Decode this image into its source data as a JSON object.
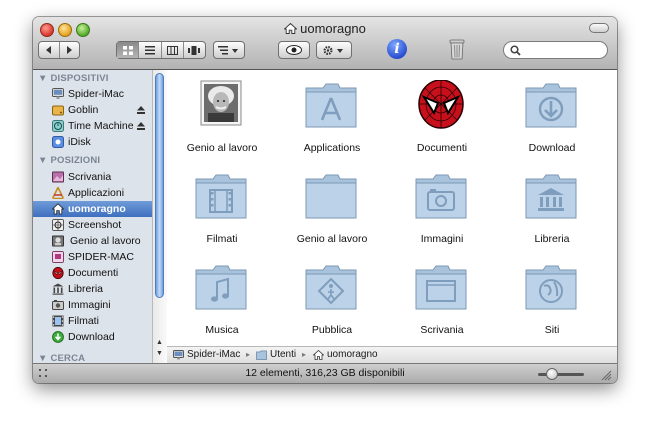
{
  "window": {
    "title": "uomoragno"
  },
  "toolbar": {
    "back_icon": "back-arrow-icon",
    "forward_icon": "forward-arrow-icon",
    "views": [
      "icon-view",
      "list-view",
      "column-view",
      "coverflow-view"
    ],
    "active_view": "icon-view",
    "search_placeholder": ""
  },
  "sidebar": {
    "sections": [
      {
        "label": "▼ DISPOSITIVI",
        "items": [
          {
            "label": "Spider-iMac",
            "icon": "imac-icon"
          },
          {
            "label": "Goblin",
            "icon": "drive-icon",
            "eject": true
          },
          {
            "label": "Time Machine",
            "icon": "time-machine-icon",
            "eject": true
          },
          {
            "label": "iDisk",
            "icon": "idisk-icon"
          }
        ]
      },
      {
        "label": "▼ POSIZIONI",
        "items": [
          {
            "label": "Scrivania",
            "icon": "desktop-icon"
          },
          {
            "label": "Applicazioni",
            "icon": "applications-icon"
          },
          {
            "label": "uomoragno",
            "icon": "home-icon",
            "selected": true
          },
          {
            "label": "Screenshot",
            "icon": "screenshot-icon"
          },
          {
            "label": "Genio al lavoro",
            "icon": "folder-icon"
          },
          {
            "label": "SPIDER-MAC",
            "icon": "computer-icon"
          },
          {
            "label": "Documenti",
            "icon": "spiderman-icon"
          },
          {
            "label": "Libreria",
            "icon": "library-icon"
          },
          {
            "label": "Immagini",
            "icon": "pictures-icon"
          },
          {
            "label": "Filmati",
            "icon": "movies-icon"
          },
          {
            "label": "Download",
            "icon": "download-icon"
          }
        ]
      },
      {
        "label": "▼ CERCA",
        "items": []
      }
    ]
  },
  "items": [
    {
      "name": "Genio al lavoro",
      "icon": "einstein-photo-icon"
    },
    {
      "name": "Applications",
      "icon": "applications-folder-icon"
    },
    {
      "name": "Documenti",
      "icon": "spiderman-icon"
    },
    {
      "name": "Download",
      "icon": "download-folder-icon"
    },
    {
      "name": "Filmati",
      "icon": "movies-folder-icon"
    },
    {
      "name": "Genio al lavoro",
      "icon": "folder-icon"
    },
    {
      "name": "Immagini",
      "icon": "pictures-folder-icon"
    },
    {
      "name": "Libreria",
      "icon": "library-folder-icon"
    },
    {
      "name": "Musica",
      "icon": "music-folder-icon"
    },
    {
      "name": "Pubblica",
      "icon": "public-folder-icon"
    },
    {
      "name": "Scrivania",
      "icon": "desktop-folder-icon"
    },
    {
      "name": "Siti",
      "icon": "sites-folder-icon"
    }
  ],
  "pathbar": {
    "segments": [
      "Spider-iMac",
      "Utenti",
      "uomoragno"
    ]
  },
  "status": {
    "text": "12 elementi, 316,23 GB disponibili"
  },
  "colors": {
    "folder": "#a9c3dd",
    "selection": "#3e6fbf",
    "sidebar": "#dde3ea"
  }
}
